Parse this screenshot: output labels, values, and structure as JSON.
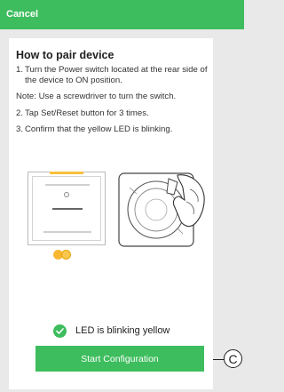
{
  "topbar": {
    "cancel_label": "Cancel"
  },
  "instructions": {
    "title": "How to pair device",
    "steps": [
      {
        "num": "1.",
        "text": "Turn the Power switch located at the rear side of the device to ON position."
      },
      {
        "num": "2.",
        "text": "Tap Set/Reset button for 3 times."
      },
      {
        "num": "3.",
        "text": "Confirm that the yellow LED is blinking."
      }
    ],
    "note": "Note: Use a screwdriver to turn the switch."
  },
  "status": {
    "text": "LED is blinking yellow",
    "icon": "check-circle-icon"
  },
  "actions": {
    "start_label": "Start Configuration"
  },
  "callout": {
    "label": "C"
  },
  "colors": {
    "accent": "#3dbd5d",
    "led_yellow": "#f7b731"
  }
}
